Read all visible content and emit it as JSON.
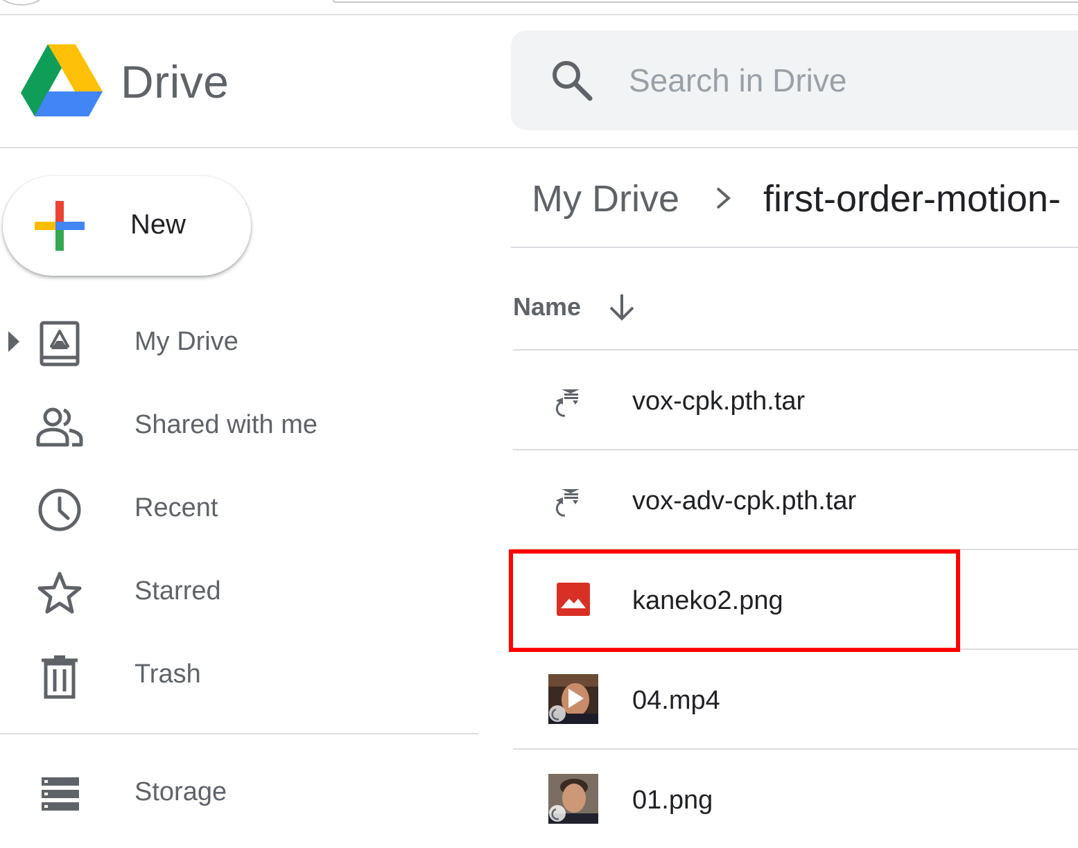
{
  "app": {
    "title": "Drive"
  },
  "search": {
    "placeholder": "Search in Drive",
    "value": ""
  },
  "new_button": {
    "label": "New"
  },
  "sidebar": {
    "items": [
      {
        "label": "My Drive",
        "icon": "my-drive-icon",
        "expandable": true
      },
      {
        "label": "Shared with me",
        "icon": "people-icon"
      },
      {
        "label": "Recent",
        "icon": "clock-icon"
      },
      {
        "label": "Starred",
        "icon": "star-icon"
      },
      {
        "label": "Trash",
        "icon": "trash-icon"
      }
    ],
    "storage": {
      "label": "Storage",
      "icon": "storage-icon"
    }
  },
  "breadcrumb": {
    "root": "My Drive",
    "current": "first-order-motion-"
  },
  "file_list": {
    "column_name": "Name",
    "sort": "descending",
    "files": [
      {
        "name": "vox-cpk.pth.tar",
        "icon": "shared-archive-icon"
      },
      {
        "name": "vox-adv-cpk.pth.tar",
        "icon": "shared-archive-icon"
      },
      {
        "name": "kaneko2.png",
        "icon": "image-icon",
        "highlighted": true
      },
      {
        "name": "04.mp4",
        "icon": "video-thumbnail-icon"
      },
      {
        "name": "01.png",
        "icon": "photo-thumbnail-icon"
      }
    ]
  },
  "colors": {
    "highlight": "#ff0000",
    "image_icon": "#d93025",
    "text_primary": "#202124",
    "text_secondary": "#5f6368",
    "search_bg": "#f1f3f4",
    "divider": "#dadce0"
  }
}
